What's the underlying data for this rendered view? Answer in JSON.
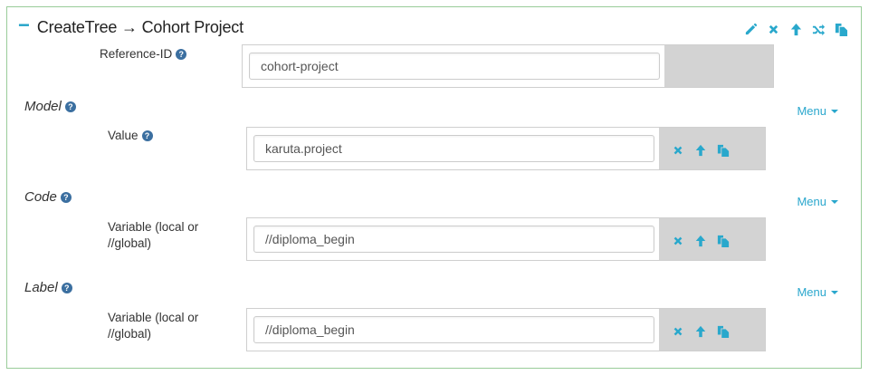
{
  "header": {
    "title": "CreateTree → Cohort Project",
    "tools": [
      "pencil-icon",
      "close-icon",
      "arrow-up-icon",
      "shuffle-icon",
      "copy-icon"
    ]
  },
  "reference": {
    "label": "Reference-ID",
    "value": "cohort-project"
  },
  "sections": [
    {
      "title": "Model",
      "menu": "Menu",
      "field_label": "Value",
      "value": "karuta.project"
    },
    {
      "title": "Code",
      "menu": "Menu",
      "field_label": "Variable (local or //global)",
      "value": "//diploma_begin"
    },
    {
      "title": "Label",
      "menu": "Menu",
      "field_label": "Variable (local or //global)",
      "value": "//diploma_begin"
    }
  ],
  "colors": {
    "accent": "#29a8cc",
    "border": "#99cc99",
    "gray_panel": "#d3d3d3",
    "help": "#3b6fa0"
  }
}
